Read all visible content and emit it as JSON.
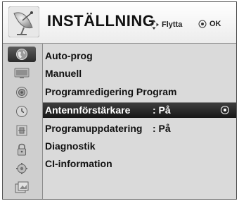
{
  "header": {
    "title": "INSTÄLLNING",
    "icon": "satellite-dish-icon",
    "hint_move_label": "Flytta",
    "hint_ok_label": "OK"
  },
  "sidebar": {
    "items": [
      {
        "icon": "globe-icon",
        "active": true
      },
      {
        "icon": "tv-screen-icon",
        "active": false
      },
      {
        "icon": "speaker-icon",
        "active": false
      },
      {
        "icon": "clock-icon",
        "active": false
      },
      {
        "icon": "lock-screen-icon",
        "active": false
      },
      {
        "icon": "padlock-icon",
        "active": false
      },
      {
        "icon": "gear-icon",
        "active": false
      },
      {
        "icon": "usb-photo-icon",
        "active": false
      }
    ]
  },
  "menu": {
    "items": [
      {
        "label": "Auto-prog",
        "value": ""
      },
      {
        "label": "Manuell",
        "value": ""
      },
      {
        "label": "Programredigering Program",
        "value": ""
      },
      {
        "label": "Antennförstärkare",
        "value": ": På",
        "selected": true
      },
      {
        "label": "Programuppdatering",
        "value": ": På"
      },
      {
        "label": "Diagnostik",
        "value": ""
      },
      {
        "label": "CI-information",
        "value": ""
      }
    ]
  },
  "colors": {
    "selected_bg": "#2a2a2a",
    "panel_bg": "#dadada",
    "header_bg": "#f2f2f2"
  }
}
